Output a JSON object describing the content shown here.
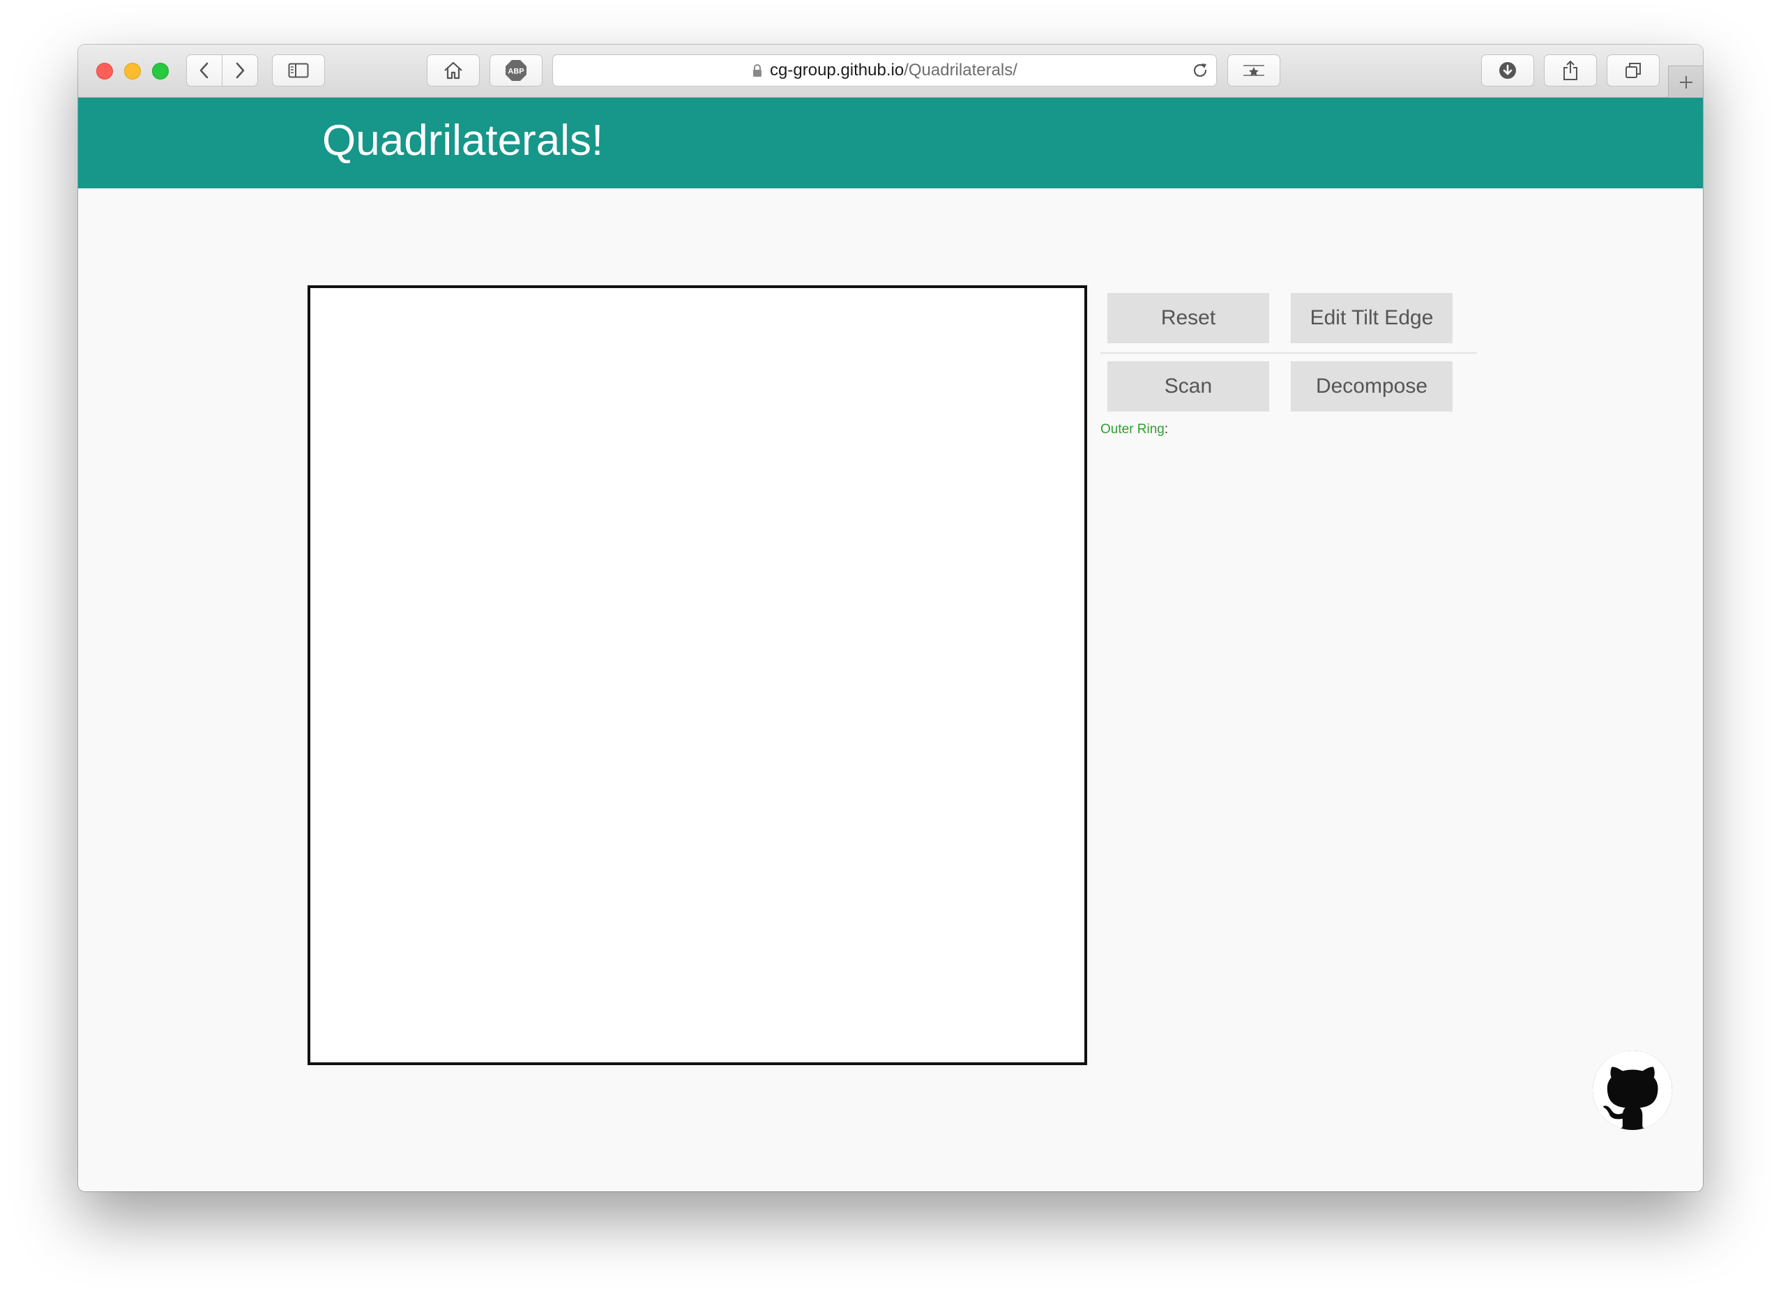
{
  "browser": {
    "url_host": "cg-group.github.io",
    "url_path": "/Quadrilaterals/",
    "icons": {
      "back": "chevron-left-icon",
      "forward": "chevron-right-icon",
      "sidebar": "sidebar-icon",
      "home": "home-icon",
      "adblock": "abp-icon",
      "lock": "lock-icon",
      "reload": "reload-icon",
      "reader": "reader-icon",
      "download": "download-icon",
      "share": "share-icon",
      "tabs": "tabs-icon",
      "new_tab": "plus-icon"
    },
    "abp_label": "ABP"
  },
  "header": {
    "title": "Quadrilaterals!",
    "background_color": "#17968a"
  },
  "controls": {
    "reset_label": "Reset",
    "edit_tilt_edge_label": "Edit Tilt Edge",
    "scan_label": "Scan",
    "decompose_label": "Decompose",
    "outer_ring_label": "Outer Ring",
    "outer_ring_separator": ":",
    "outer_ring_color": "#2f9e2f"
  },
  "footer": {
    "github_icon": "github-icon"
  }
}
